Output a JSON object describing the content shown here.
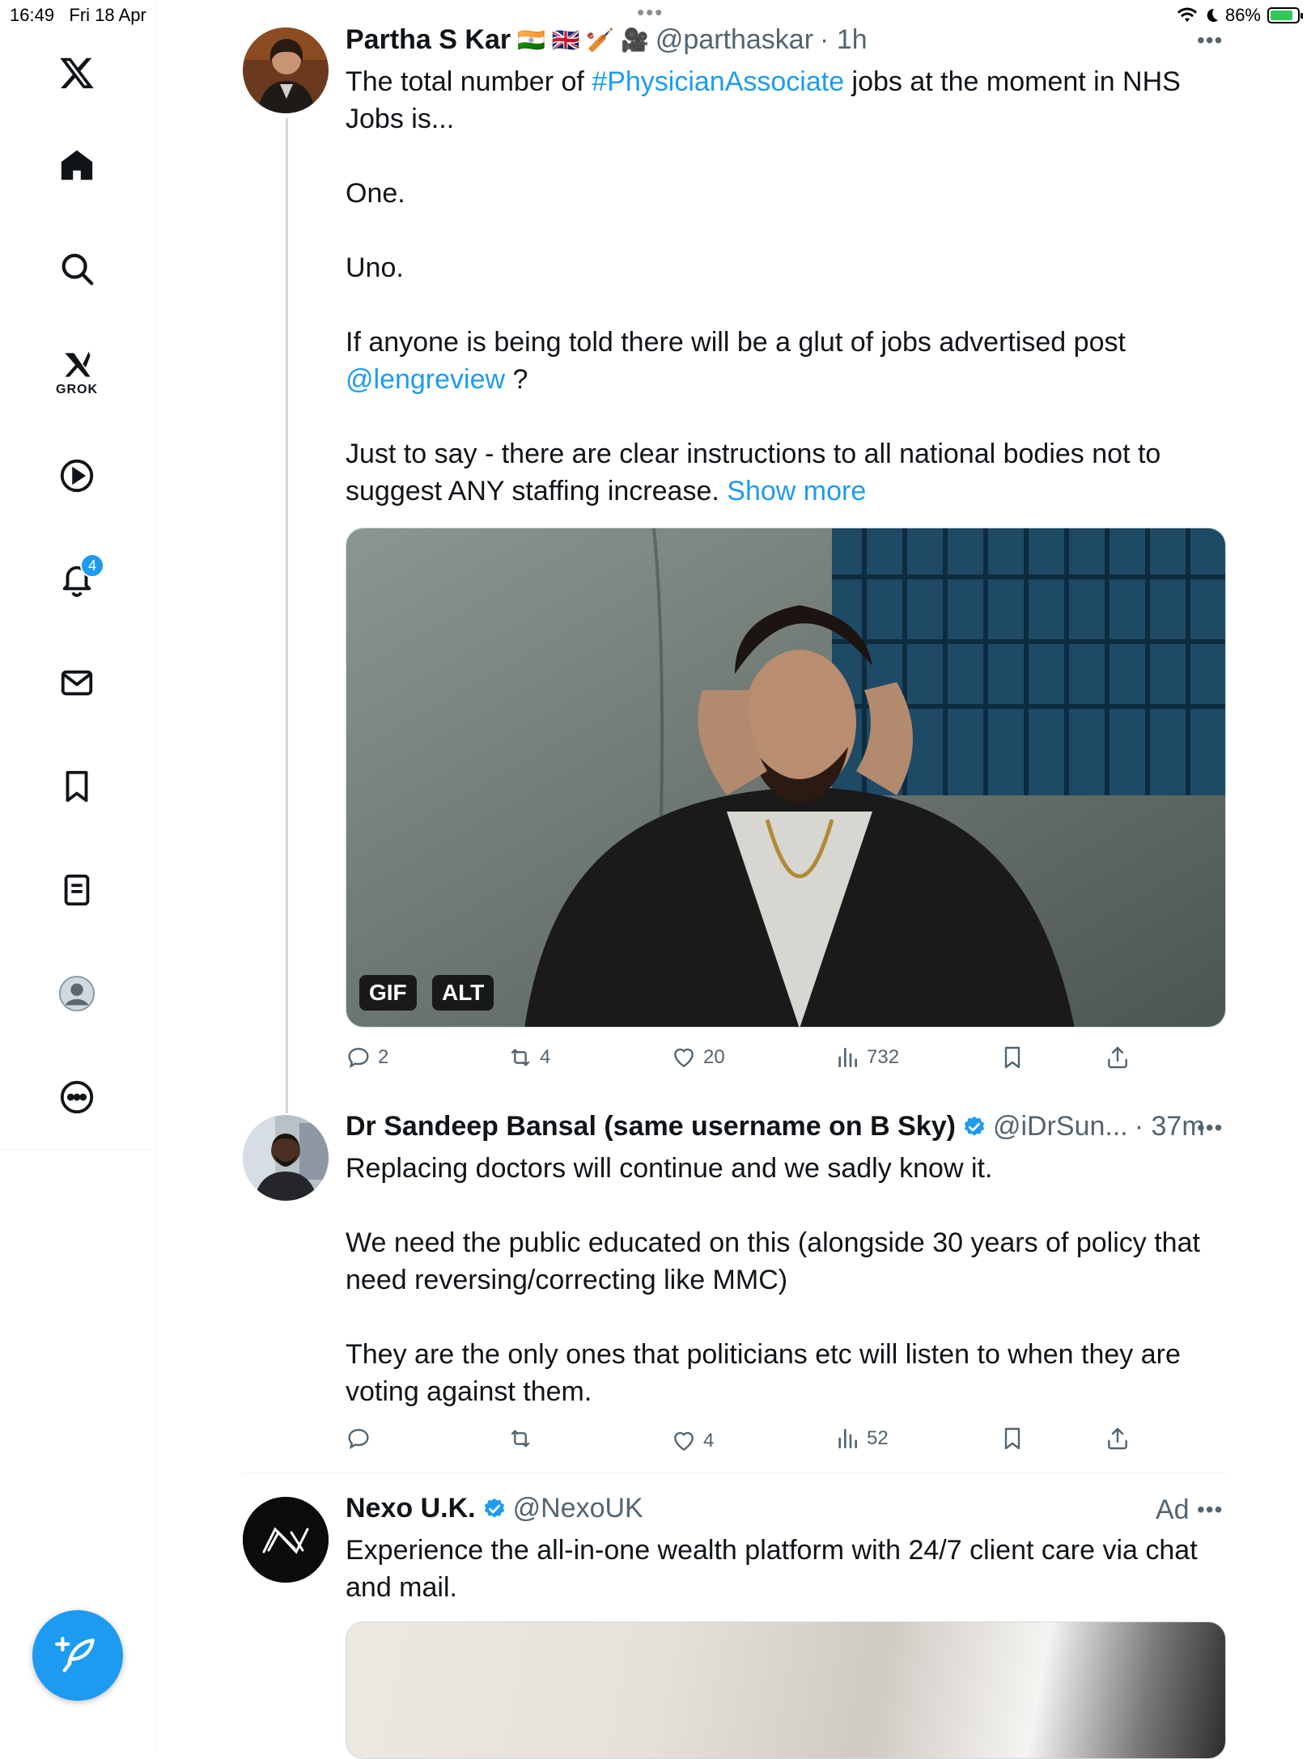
{
  "status_bar": {
    "time": "16:49",
    "date": "Fri 18 Apr",
    "battery_percent": "86%",
    "battery_level": 0.86
  },
  "sidebar": {
    "items": [
      {
        "name": "x-logo",
        "label": ""
      },
      {
        "name": "home",
        "label": ""
      },
      {
        "name": "explore",
        "label": ""
      },
      {
        "name": "grok",
        "label": "GROK"
      },
      {
        "name": "video",
        "label": ""
      },
      {
        "name": "notifications",
        "label": "",
        "badge": "4"
      },
      {
        "name": "messages",
        "label": ""
      },
      {
        "name": "bookmarks",
        "label": ""
      },
      {
        "name": "lists",
        "label": ""
      },
      {
        "name": "profile",
        "label": ""
      },
      {
        "name": "more",
        "label": ""
      }
    ]
  },
  "tweets": [
    {
      "name": "Partha S Kar",
      "flags": "🇮🇳 🇬🇧 🏏 🎥",
      "handle": "@parthaskar",
      "time": "· 1h",
      "text_1": "The total number of ",
      "hashtag": "#PhysicianAssociate",
      "text_2": " jobs at the moment in NHS\nJobs is...\n\nOne.\n\nUno.\n\nIf anyone is being told there will be a glut of jobs advertised post\n",
      "mention": "@lengreview",
      "text_3": " ?\n\nJust to say - there are clear instructions to all national bodies not to\nsuggest ANY staffing increase. ",
      "show_more": "Show more",
      "media_tags": [
        "GIF",
        "ALT"
      ],
      "stats": {
        "replies": "2",
        "reposts": "4",
        "likes": "20",
        "views": "732"
      }
    },
    {
      "name": "Dr Sandeep Bansal (same username on B Sky)",
      "handle": "@iDrSun...",
      "time": "· 37m",
      "text": "Replacing doctors will continue and we sadly know it.\n\nWe need the public educated on this (alongside 30 years of policy that\nneed reversing/correcting like MMC)\n\nThey are the only ones that politicians etc will listen to when they are\nvoting against them.",
      "stats": {
        "replies": "",
        "reposts": "",
        "likes": "4",
        "views": "52"
      }
    },
    {
      "name": "Nexo U.K.",
      "handle": "@NexoUK",
      "ad_label": "Ad",
      "text": "Experience the all-in-one wealth platform with 24/7 client care via chat\nand mail."
    }
  ],
  "colors": {
    "accent": "#1d9bf0",
    "text": "#0f1419",
    "secondary": "#536471",
    "battery_green": "#34c759"
  }
}
